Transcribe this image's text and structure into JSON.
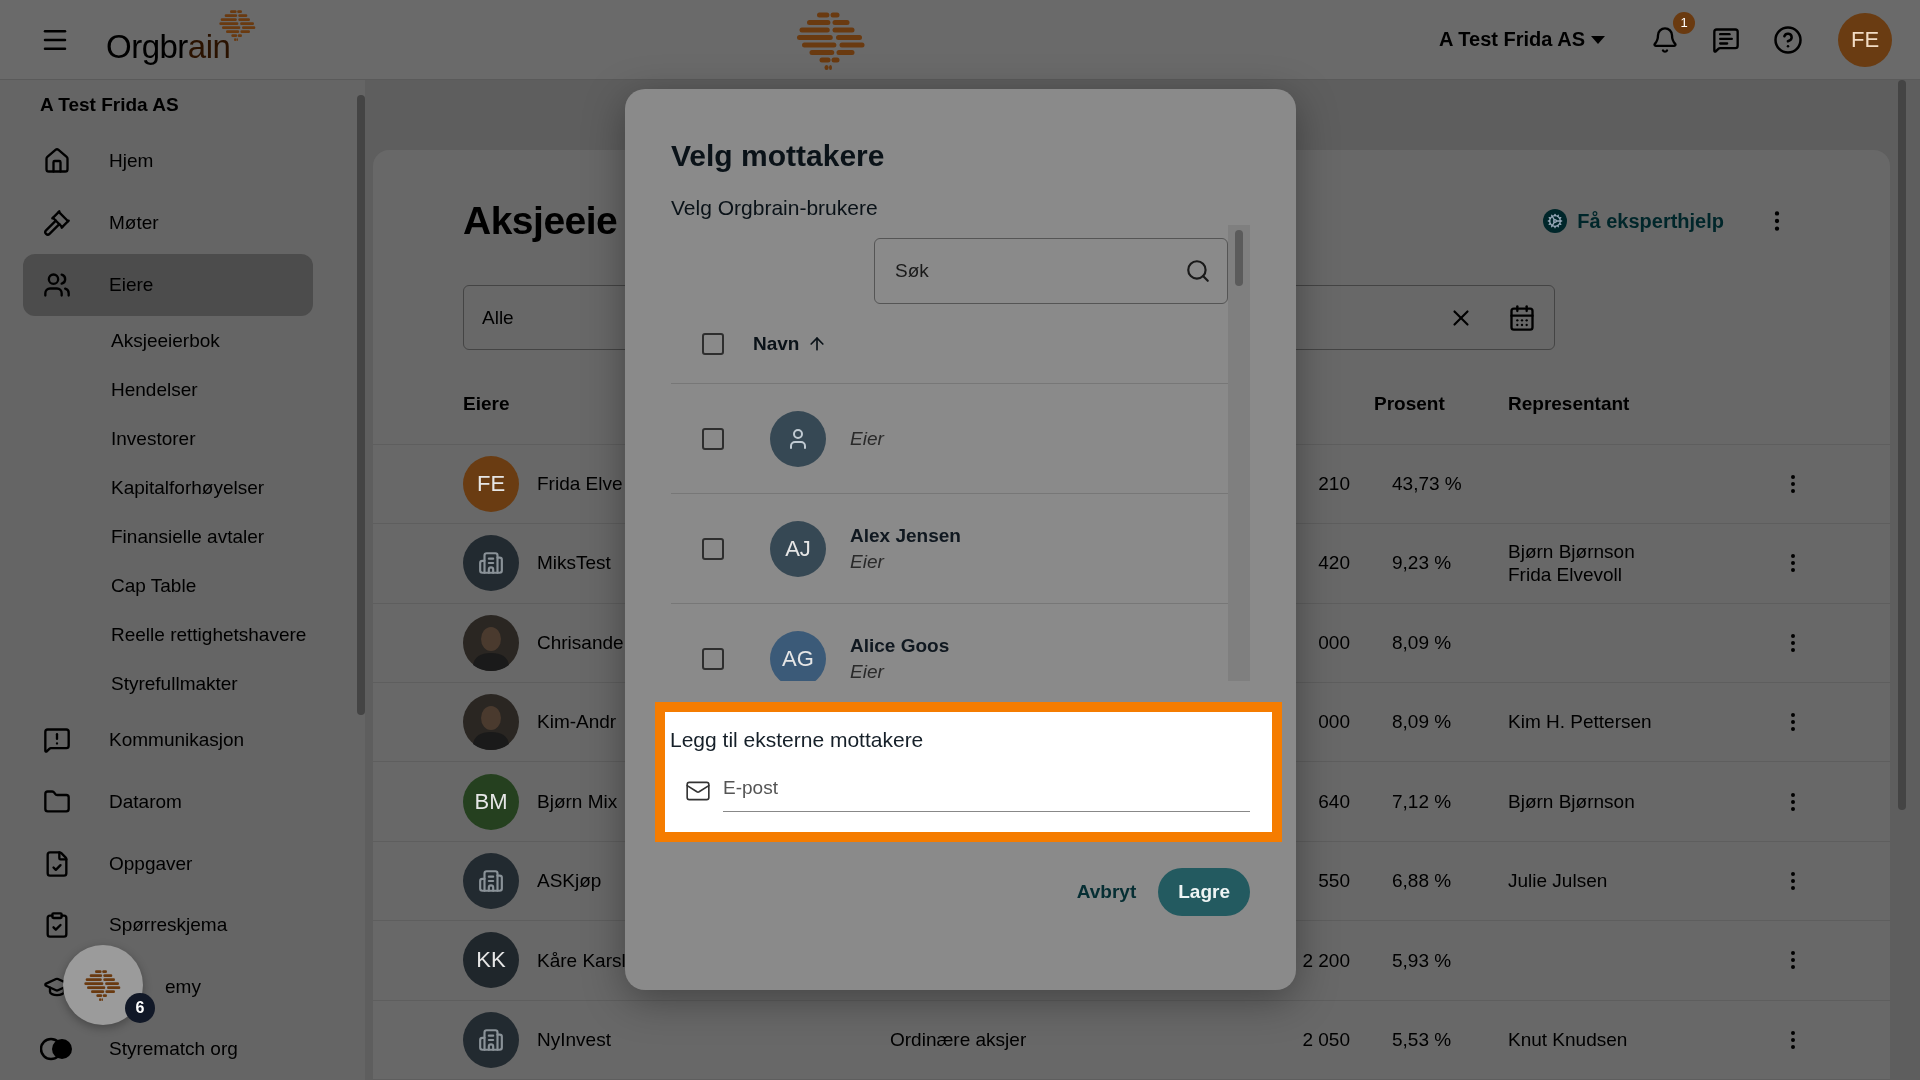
{
  "top_bar": {
    "logo": {
      "text": "Orgbr",
      "accent": "ain"
    },
    "company": "A Test Frida AS",
    "notification_count": "1",
    "avatar_initials": "FE"
  },
  "sidebar": {
    "organization": "A Test Frida AS",
    "items": [
      {
        "label": "Hjem",
        "selected": false
      },
      {
        "label": "Møter",
        "selected": false
      },
      {
        "label": "Eiere",
        "selected": true,
        "expanded": true,
        "children": [
          {
            "label": "Aksjeeierbok",
            "selected": false
          },
          {
            "label": "Hendelser",
            "selected": false
          },
          {
            "label": "Investorer",
            "selected": false
          },
          {
            "label": "Kapitalforhøyelser",
            "selected": false
          },
          {
            "label": "Finansielle avtaler",
            "selected": false
          },
          {
            "label": "Cap Table",
            "selected": false
          },
          {
            "label": "Reelle rettighetshavere",
            "selected": false
          },
          {
            "label": "Styrefullmakter",
            "selected": false
          }
        ]
      },
      {
        "label": "Kommunikasjon",
        "selected": false
      },
      {
        "label": "Datarom",
        "selected": false
      },
      {
        "label": "Oppgaver",
        "selected": false
      },
      {
        "label": "Spørreskjema",
        "selected": false
      },
      {
        "label": "emy",
        "selected": false
      },
      {
        "label": "Styrematch org",
        "selected": false
      }
    ]
  },
  "page": {
    "title": "Aksjeeie",
    "help_link": "Få eksperthjelp",
    "filter_value": "Alle",
    "table": {
      "columns": [
        "Eiere",
        "Prosent",
        "Representant"
      ],
      "rows": [
        {
          "avatar": {
            "kind": "initials",
            "text": "FE",
            "color": "#6a3c12"
          },
          "name": "Frida Elve",
          "column_3": "210",
          "percent": "43,73 %"
        },
        {
          "avatar": {
            "kind": "company"
          },
          "name": "MiksTest",
          "column_3": "420",
          "percent": "9,23 %",
          "representatives": [
            "Bjørn Bjørnson",
            "Frida Elvevoll"
          ]
        },
        {
          "avatar": {
            "kind": "picture"
          },
          "name": "Chrisande",
          "column_3": "000",
          "percent": "8,09 %"
        },
        {
          "avatar": {
            "kind": "picture"
          },
          "name": "Kim-Andr",
          "column_3": "000",
          "percent": "8,09 %",
          "representatives": [
            "Kim H. Pettersen"
          ]
        },
        {
          "avatar": {
            "kind": "initials",
            "text": "BM",
            "color": "#25401f"
          },
          "name": "Bjørn Mix",
          "column_3": "640",
          "percent": "7,12 %",
          "representatives": [
            "Bjørn Bjørnson"
          ]
        },
        {
          "avatar": {
            "kind": "company"
          },
          "name": "ASKjøp",
          "column_3": "550",
          "percent": "6,88 %",
          "representatives": [
            "Julie Julsen"
          ]
        },
        {
          "avatar": {
            "kind": "initials",
            "text": "KK",
            "color": "#1f262b"
          },
          "name": "Kåre Karsl",
          "column_3": "2 200",
          "percent": "5,93 %"
        },
        {
          "avatar": {
            "kind": "company"
          },
          "name": "NyInvest",
          "column_2": "Ordinære aksjer",
          "column_3": "2 050",
          "percent": "5,53 %",
          "representatives": [
            "Knut Knudsen"
          ]
        }
      ]
    }
  },
  "dialog": {
    "title": "Velg mottakere",
    "subtitle": "Velg Orgbrain-brukere",
    "search": {
      "placeholder": "Søk"
    },
    "header": {
      "label": "Navn",
      "checked": false,
      "sorted_ascending": true
    },
    "users": [
      {
        "avatar": {
          "kind": "generic"
        },
        "role": "Eier",
        "checked": false
      },
      {
        "avatar": {
          "kind": "initials",
          "text": "AJ",
          "color": "#364854"
        },
        "name": "Alex Jensen",
        "role": "Eier",
        "checked": false
      },
      {
        "avatar": {
          "kind": "initials",
          "text": "AG",
          "color": "#3b5a78"
        },
        "name": "Alice Goos",
        "role": "Eier",
        "checked": false
      }
    ],
    "external": {
      "title": "Legg til eksterne mottakere",
      "placeholder": "E-post",
      "highlighted": true
    },
    "buttons": [
      {
        "label": "Avbryt",
        "kind": "text"
      },
      {
        "label": "Lagre",
        "kind": "primary"
      }
    ]
  },
  "chat_button": {
    "badge": "6"
  }
}
